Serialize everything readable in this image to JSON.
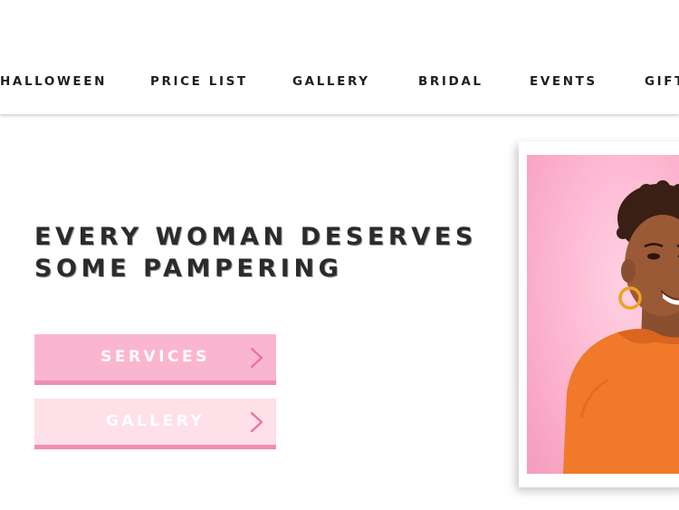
{
  "nav": {
    "items": [
      {
        "label": "HALLOWEEN"
      },
      {
        "label": "PRICE LIST"
      },
      {
        "label": "GALLERY"
      },
      {
        "label": "BRIDAL"
      },
      {
        "label": "EVENTS"
      },
      {
        "label": "GIFT"
      }
    ]
  },
  "hero": {
    "headline_line1": "EVERY WOMAN DESERVES",
    "headline_line2": "SOME PAMPERING",
    "buttons": {
      "services_label": "SERVICES",
      "gallery_label": "GALLERY"
    }
  },
  "colors": {
    "services_button": "#fbb6cf",
    "gallery_button": "#fde0e8",
    "button_underline": "#f28db2",
    "chevron": "#f06e9e",
    "photo_background": "#fdb7d0",
    "sweater": "#f07a2a"
  }
}
